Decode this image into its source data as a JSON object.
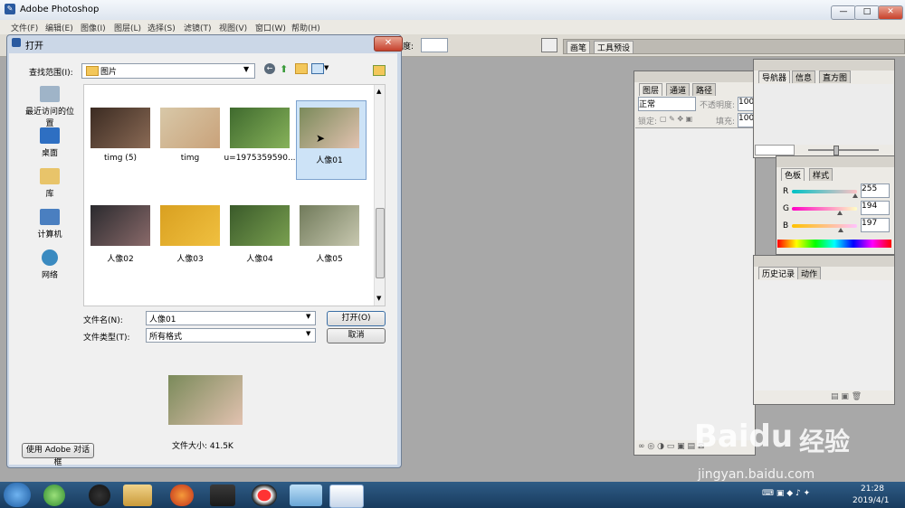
{
  "app": {
    "title": "Adobe Photoshop",
    "menu": [
      "文件(F)",
      "编辑(E)",
      "图像(I)",
      "图层(L)",
      "选择(S)",
      "滤镜(T)",
      "视图(V)",
      "窗口(W)",
      "帮助(H)"
    ],
    "options_label": "度:",
    "window_controls": {
      "minimize": "—",
      "maximize": "□",
      "close": "✕"
    }
  },
  "panels": {
    "top_tabs": [
      "画笔",
      "工具预设"
    ],
    "layers": {
      "tabs": [
        "图层",
        "通道",
        "路径"
      ],
      "blend_mode": "正常",
      "opacity_label": "不透明度:",
      "opacity_value": "100%",
      "lock_label": "锁定:",
      "fill_label": "填充:",
      "fill_value": "100%"
    },
    "navigator": {
      "tabs": [
        "导航器",
        "信息",
        "直方图"
      ]
    },
    "color": {
      "tabs": [
        "色板",
        "样式"
      ],
      "channels": [
        {
          "name": "R",
          "value": "255",
          "level": 1.0
        },
        {
          "name": "G",
          "value": "194",
          "level": 0.76
        },
        {
          "name": "B",
          "value": "197",
          "level": 0.77
        }
      ]
    },
    "history": {
      "tabs": [
        "历史记录",
        "动作"
      ]
    }
  },
  "dialog": {
    "title": "打开",
    "look_in_label": "查找范围(I):",
    "look_in_value": "图片",
    "places": [
      {
        "label": "最近访问的位置",
        "icon": "recent-places-icon"
      },
      {
        "label": "桌面",
        "icon": "desktop-icon"
      },
      {
        "label": "库",
        "icon": "library-icon"
      },
      {
        "label": "计算机",
        "icon": "computer-icon"
      },
      {
        "label": "网络",
        "icon": "network-icon"
      }
    ],
    "files": [
      {
        "name": "timg (5)",
        "colors": [
          "#3b2b22",
          "#8a6a55"
        ]
      },
      {
        "name": "timg",
        "colors": [
          "#d8c8a8",
          "#c9a27a"
        ]
      },
      {
        "name": "u=1975359590...",
        "colors": [
          "#3f6a2e",
          "#87b25a"
        ]
      },
      {
        "name": "人像01",
        "colors": [
          "#7a8a5a",
          "#e2c2b0"
        ],
        "selected": true
      },
      {
        "name": "人像02",
        "colors": [
          "#2a2a2e",
          "#8a6a6a"
        ]
      },
      {
        "name": "人像03",
        "colors": [
          "#d9a020",
          "#f0c040"
        ]
      },
      {
        "name": "人像04",
        "colors": [
          "#3a5a2a",
          "#7aa050"
        ]
      },
      {
        "name": "人像05",
        "colors": [
          "#707a5a",
          "#c8c8b0"
        ]
      }
    ],
    "filename_label": "文件名(N):",
    "filename_value": "人像01",
    "filetype_label": "文件类型(T):",
    "filetype_value": "所有格式",
    "open_button": "打开(O)",
    "cancel_button": "取消",
    "filesize_label": "文件大小: 41.5K",
    "adobe_dialog_button": "使用 Adobe 对话框"
  },
  "taskbar": {
    "items": [
      "start",
      "360-browser",
      "qq",
      "file-explorer",
      "firefox",
      "media-player",
      "recorder",
      "ie",
      "photoshop"
    ],
    "time": "21:28",
    "date": "2019/4/1"
  },
  "watermark": {
    "brand": "Baidu",
    "brand_cn": "经验",
    "url": "jingyan.baidu.com"
  },
  "colors": {
    "accent": "#3a6ea5",
    "selection": "#cde3f7",
    "taskbar": "#1e4a73"
  }
}
